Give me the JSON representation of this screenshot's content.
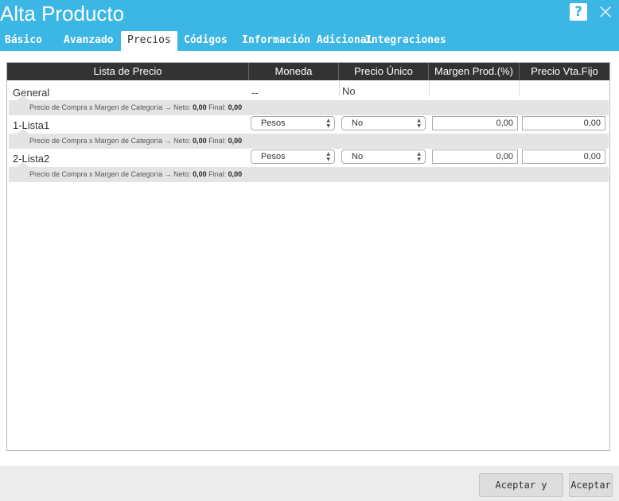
{
  "window": {
    "title": "Alta Producto",
    "help_icon": "?",
    "close_icon": "×"
  },
  "tabs": [
    {
      "label": "Básico",
      "active": false
    },
    {
      "label": "Avanzado",
      "active": false
    },
    {
      "label": "Precios",
      "active": true
    },
    {
      "label": "Códigos",
      "active": false
    },
    {
      "label": "Información Adicional",
      "active": false
    },
    {
      "label": "Integraciones",
      "active": false
    }
  ],
  "table": {
    "headers": [
      "Lista de Precio",
      "Moneda",
      "Precio Único",
      "Margen Prod.(%)",
      "Precio Vta.Fijo"
    ],
    "rows": [
      {
        "name": "General",
        "moneda": "--",
        "precio_unico": "No",
        "margen": "",
        "precio_fijo": "",
        "info_prefix": "Precio de Compra x Margen de Categoría → Neto: ",
        "info_neto": "0,00",
        "info_mid": " Final: ",
        "info_final": "0,00"
      },
      {
        "name": "1-Lista1",
        "moneda": "Pesos",
        "precio_unico": "No",
        "margen": "0,00",
        "precio_fijo": "0,00",
        "info_prefix": "Precio de Compra x Margen de Categoría → Neto: ",
        "info_neto": "0,00",
        "info_mid": " Final: ",
        "info_final": "0,00"
      },
      {
        "name": "2-Lista2",
        "moneda": "Pesos",
        "precio_unico": "No",
        "margen": "0,00",
        "precio_fijo": "0,00",
        "info_prefix": "Precio de Compra x Margen de Categoría → Neto: ",
        "info_neto": "0,00",
        "info_mid": " Final: ",
        "info_final": "0,00"
      }
    ]
  },
  "footer": {
    "accept_new_label": "Aceptar y Nuevo",
    "accept_label": "Aceptar"
  },
  "colors": {
    "header_bg": "#3cb6e4",
    "table_header_bg": "#333333",
    "info_row_bg": "#e4e4e4"
  },
  "icons": {
    "help": "help-icon",
    "close": "close-icon",
    "select_arrows": "updown-arrows-icon"
  }
}
